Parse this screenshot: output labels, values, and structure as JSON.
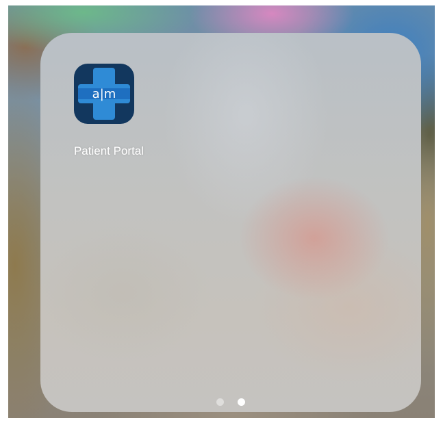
{
  "folder": {
    "apps": [
      {
        "label": "Patient Portal",
        "icon": "a|m medical cross app icon",
        "icon_text": "a|m",
        "icon_colors": {
          "background": "#12375e",
          "cross": "#2f8bd6",
          "band": "#1e6fc0",
          "text": "#ffffff"
        }
      }
    ],
    "page_indicator": {
      "total_pages": 2,
      "current_page": 2
    }
  }
}
